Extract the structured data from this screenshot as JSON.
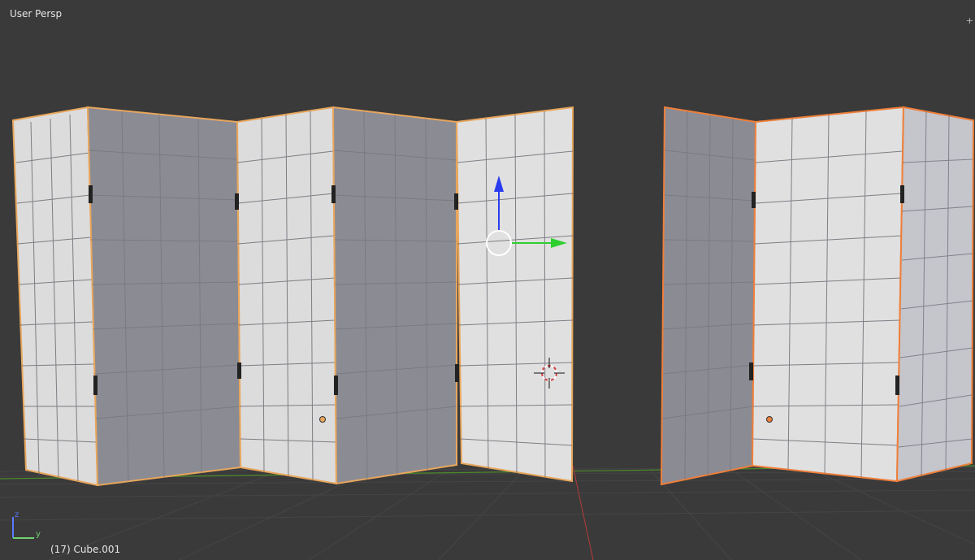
{
  "viewport": {
    "view_label": "User Persp",
    "object_label": "(17) Cube.001",
    "corner_glyph": "+",
    "axis_z_label": "z",
    "axis_y_label": "y"
  },
  "colors": {
    "background": "#3a3a3a",
    "grid": "#454545",
    "x_axis": "#a33b3b",
    "y_axis": "#4b8a2a",
    "panel_light": "#e6e6e6",
    "panel_dark": "#8b8b94",
    "tile_line": "#555560",
    "selection_outline": "#e8a65c",
    "active_outline": "#ef7f3a",
    "gizmo_z": "#2a3cf0",
    "gizmo_y": "#2fcf2f"
  },
  "icons": {
    "gizmo": "translate-gizmo-icon",
    "cursor": "3d-cursor-icon",
    "origin": "object-origin-icon",
    "orientation": "view-axis-icon"
  }
}
